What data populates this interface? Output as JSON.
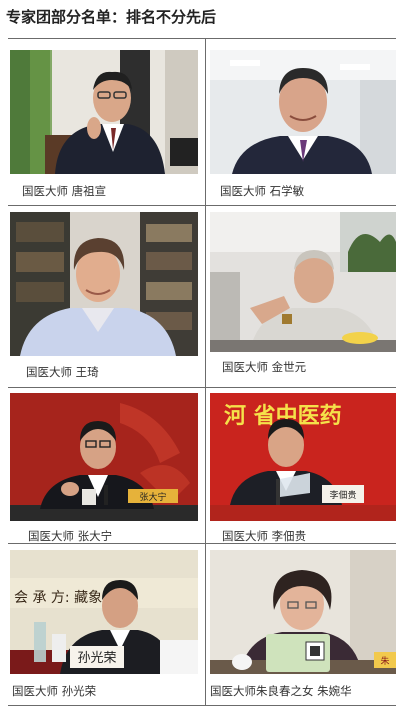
{
  "page": {
    "title": "专家团部分名单：排名不分先后"
  },
  "experts": [
    {
      "caption": "国医大师 唐祖宣",
      "plaque": ""
    },
    {
      "caption": "国医大师 石学敏",
      "plaque": ""
    },
    {
      "caption": "国医大师 王琦",
      "plaque": ""
    },
    {
      "caption": "国医大师 金世元",
      "plaque": ""
    },
    {
      "caption": "国医大师 张大宁",
      "plaque": "张大宁"
    },
    {
      "caption": "国医大师 李佃贵",
      "plaque": "李佃贵",
      "banner": "河 省中医药"
    },
    {
      "caption": "国医大师 孙光荣",
      "plaque": "孙光荣",
      "banner": "会  承    方: 藏象"
    },
    {
      "caption": "国医大师朱良春之女 朱婉华",
      "plaque": "朱"
    }
  ]
}
